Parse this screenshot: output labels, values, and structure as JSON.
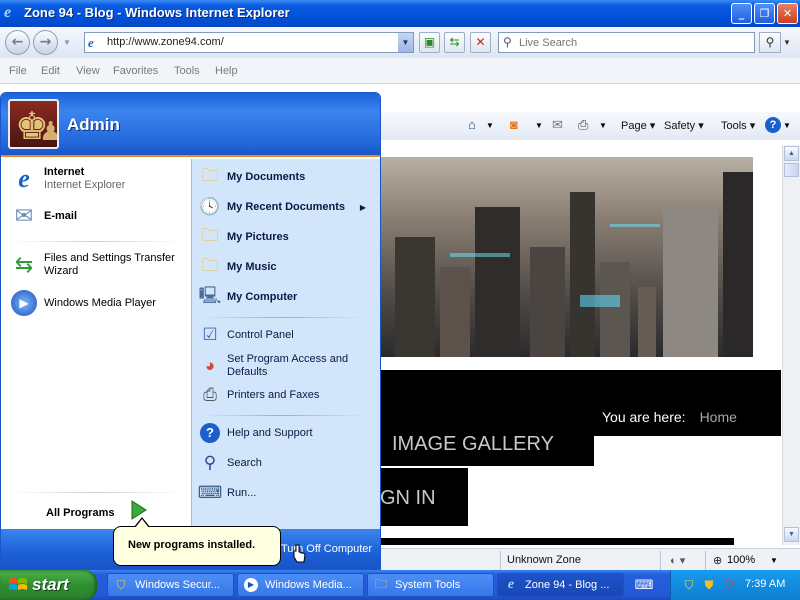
{
  "window": {
    "title": "Zone 94 - Blog - Windows Internet Explorer",
    "minimize": "_",
    "maximize": "❐",
    "close": "✕"
  },
  "addressbar": {
    "url": "http://www.zone94.com/",
    "search_placeholder": "Live Search"
  },
  "menubar": [
    "File",
    "Edit",
    "View",
    "Favorites",
    "Tools",
    "Help"
  ],
  "commandbar": {
    "page": "Page ▾",
    "safety": "Safety ▾",
    "tools": "Tools ▾",
    "help": "?"
  },
  "webpage": {
    "gallery": "IMAGE GALLERY",
    "signin": "GN IN",
    "breadcrumb_prefix": "You are here:",
    "breadcrumb_home": "Home"
  },
  "statusbar": {
    "zone": "Unknown Zone",
    "zoom": "100%"
  },
  "startmenu": {
    "user": "Admin",
    "pinned": [
      {
        "title": "Internet",
        "subtitle": "Internet Explorer",
        "icon": "internet-explorer-icon"
      },
      {
        "title": "E-mail",
        "subtitle": "",
        "icon": "email-icon"
      }
    ],
    "recent": [
      {
        "label": "Files and Settings Transfer Wizard",
        "icon": "transfer-wizard-icon"
      },
      {
        "label": "Windows Media Player",
        "icon": "media-player-icon"
      }
    ],
    "all_programs": "All Programs",
    "right": [
      {
        "label": "My Documents",
        "icon": "folder-icon",
        "bold": true
      },
      {
        "label": "My Recent Documents",
        "icon": "recent-documents-icon",
        "bold": true
      },
      {
        "label": "My Pictures",
        "icon": "folder-icon",
        "bold": true
      },
      {
        "label": "My Music",
        "icon": "folder-icon",
        "bold": true
      },
      {
        "label": "My Computer",
        "icon": "computer-icon",
        "bold": true
      },
      {
        "label": "Control Panel",
        "icon": "control-panel-icon",
        "bold": false
      },
      {
        "label": "Set Program Access and Defaults",
        "icon": "program-access-icon",
        "bold": false
      },
      {
        "label": "Printers and Faxes",
        "icon": "printer-icon",
        "bold": false
      },
      {
        "label": "Help and Support",
        "icon": "help-icon",
        "bold": false
      },
      {
        "label": "Search",
        "icon": "search-icon",
        "bold": false
      },
      {
        "label": "Run...",
        "icon": "run-icon",
        "bold": false
      }
    ],
    "turn_off": "Turn Off Computer",
    "balloon": "New programs installed."
  },
  "taskbar": {
    "start": "start",
    "tasks": [
      {
        "label": "Windows Secur...",
        "icon": "shield-icon"
      },
      {
        "label": "Windows Media...",
        "icon": "media-player-icon"
      },
      {
        "label": "System Tools",
        "icon": "folder-icon"
      },
      {
        "label": "Zone 94 - Blog ...",
        "icon": "internet-explorer-icon"
      }
    ],
    "clock": "7:39 AM"
  }
}
